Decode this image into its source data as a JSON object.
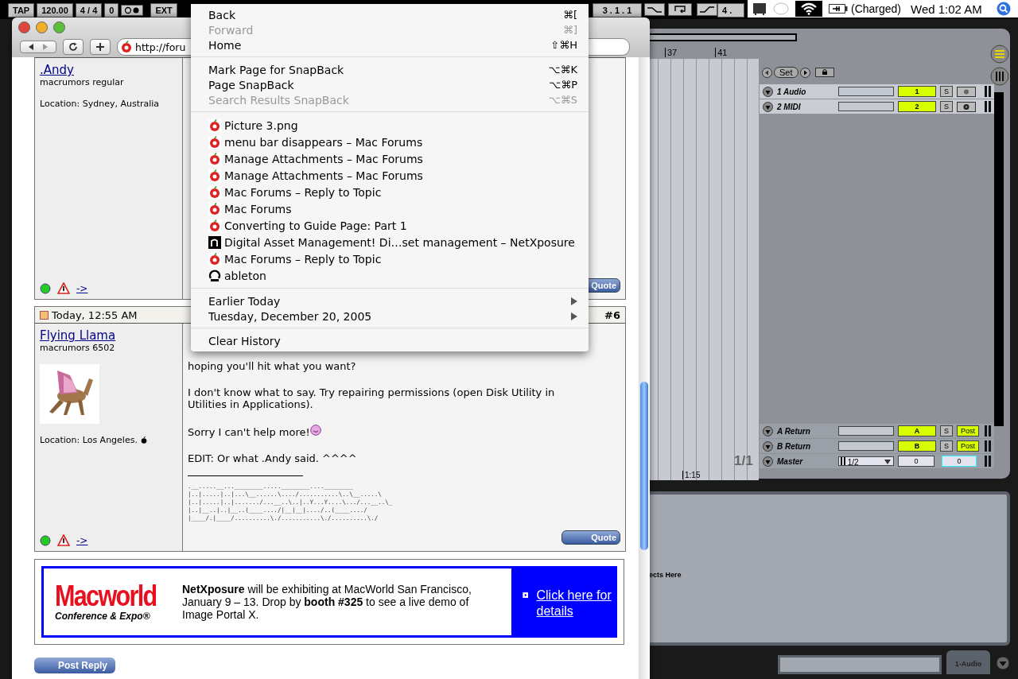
{
  "menubar": {
    "battery": "(Charged)",
    "clock": "Wed 1:02 AM"
  },
  "transport": {
    "buttons": [
      "TAP",
      "120.00",
      "4 / 4",
      "0"
    ],
    "ext": "EXT",
    "position": "3 . 1 . 1",
    "position_right": "4 ."
  },
  "arrangement": {
    "ruler": [
      "37",
      "41"
    ],
    "set_button": "Set",
    "loop": "1/1",
    "time": "1:15",
    "tracks": [
      {
        "kind": "audio",
        "name": "1 Audio",
        "button": "1",
        "solo": "S"
      },
      {
        "kind": "midi",
        "name": "2 MIDI",
        "button": "2",
        "solo": "S"
      }
    ],
    "returns": [
      {
        "kind": "return",
        "name": "A Return",
        "button": "A",
        "solo": "S",
        "send": "Post"
      },
      {
        "kind": "return",
        "name": "B Return",
        "button": "B",
        "solo": "S",
        "send": "Post"
      },
      {
        "kind": "master",
        "name": "Master",
        "routing": "1/2",
        "button": "0",
        "send": "0"
      }
    ]
  },
  "detail": {
    "hint": "ects Here",
    "tab": "1-Audio"
  },
  "browser": {
    "url": "http://foru"
  },
  "menu": [
    {
      "kind": "command",
      "label": "Back",
      "shortcut": "⌘[",
      "disabled": false
    },
    {
      "kind": "command",
      "label": "Forward",
      "shortcut": "⌘]",
      "disabled": true
    },
    {
      "kind": "command",
      "label": "Home",
      "shortcut": "⇧⌘H",
      "disabled": false
    },
    {
      "kind": "separator"
    },
    {
      "kind": "command",
      "label": "Mark Page for SnapBack",
      "shortcut": "⌥⌘K",
      "disabled": false
    },
    {
      "kind": "command",
      "label": "Page SnapBack",
      "shortcut": "⌥⌘P",
      "disabled": false
    },
    {
      "kind": "command",
      "label": "Search Results SnapBack",
      "shortcut": "⌥⌘S",
      "disabled": true
    },
    {
      "kind": "separator"
    },
    {
      "kind": "forum",
      "label": "Picture 3.png"
    },
    {
      "kind": "forum",
      "label": "menu bar disappears – Mac Forums"
    },
    {
      "kind": "forum",
      "label": "Manage Attachments – Mac Forums"
    },
    {
      "kind": "forum",
      "label": "Manage Attachments – Mac Forums"
    },
    {
      "kind": "forum",
      "label": "Mac Forums – Reply to Topic"
    },
    {
      "kind": "forum",
      "label": "Mac Forums"
    },
    {
      "kind": "forum",
      "label": "Converting to Guide Page: Part 1"
    },
    {
      "kind": "site",
      "label": "Digital Asset Management! Di…set management – NetXposure"
    },
    {
      "kind": "forum",
      "label": "Mac Forums – Reply to Topic"
    },
    {
      "kind": "app",
      "label": "ableton"
    },
    {
      "kind": "separator"
    },
    {
      "kind": "submenu",
      "label": "Earlier Today"
    },
    {
      "kind": "submenu",
      "label": "Tuesday, December 20, 2005"
    },
    {
      "kind": "separator"
    },
    {
      "kind": "command",
      "label": "Clear History",
      "disabled": false
    }
  ],
  "posts": [
    {
      "user": ".Andy",
      "rank": "macrumors regular",
      "location": "Location: Sydney, Australia",
      "link": "->",
      "quote": "Quote"
    },
    {
      "date": "Today, 12:55 AM",
      "number": "#6",
      "user": "Flying Llama",
      "rank": "macrumors 6502",
      "avatar": {
        "kind": "picture"
      },
      "location": "Location: Los Angeles.",
      "link": "->",
      "quote": "Quote",
      "paragraphs": [
        "hoping you'll hit what you want?",
        "I don't know what to say. Try repairing permissions (open Disk Utility in Utilities in Applications).",
        "Sorry I can't help more!",
        "EDIT: Or what .Andy said. ^^^^"
      ],
      "signature": [
        ".__.....__...________.....________....________",
        "|..|.....|..|...\\__......\\..../...........\\..\\__.....\\",
        "|..|.....|..|......./...__..\\..|..Y...Y....\\.../...__..\\_",
        "|..|__..|..|__..(____..../|__|__|..../..(____..../",
        "|____/.|____/..........\\./...........\\./..........\\./"
      ]
    }
  ],
  "ad": {
    "logo": "Macworld",
    "logo_sub": "Conference & Expo®",
    "text": "**NetXposure** will be exhibiting at MacWorld San Francisco, January 9 – 13. Drop by **booth #325** to see a live demo of Image Portal X.",
    "link": "Click here for details"
  },
  "post_reply": "Post Reply"
}
